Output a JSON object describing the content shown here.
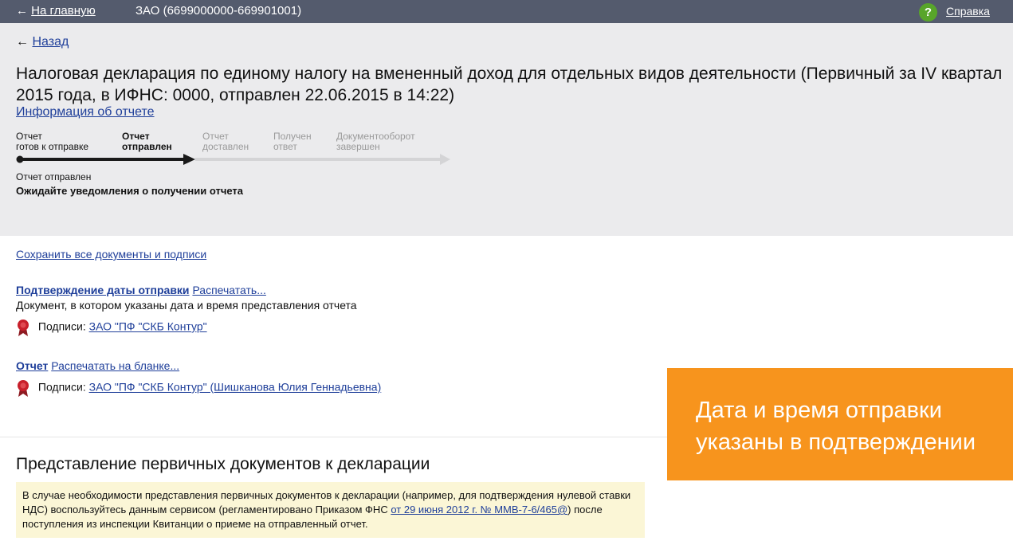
{
  "topbar": {
    "back_arrow": "←",
    "home_link": "На главную",
    "org": "ЗАО (6699000000-669901001)",
    "help_icon_glyph": "?",
    "help_link": "Справка"
  },
  "nav": {
    "back_arrow": "←",
    "back_link": "Назад"
  },
  "report": {
    "title": "Налоговая декларация по единому налогу на вмененный доход для отдельных видов деятельности (Первичный за IV квартал 2015 года, в ИФНС: 0000, отправлен 22.06.2015 в 14:22)",
    "info_link": "Информация об отчете"
  },
  "progress": {
    "steps": [
      {
        "line1": "Отчет",
        "line2": "готов к отправке"
      },
      {
        "line1": "Отчет",
        "line2": "отправлен"
      },
      {
        "line1": "Отчет",
        "line2": "доставлен"
      },
      {
        "line1": "Получен",
        "line2": "ответ"
      },
      {
        "line1": "Документооборот",
        "line2": "завершен"
      }
    ],
    "status": "Отчет отправлен",
    "status_detail": "Ожидайте уведомления о получении отчета"
  },
  "documents": {
    "save_all_link": "Сохранить все документы и подписи",
    "confirmation": {
      "title": "Подтверждение даты отправки",
      "print_link": "Распечатать...",
      "description": "Документ, в котором указаны дата и время представления отчета",
      "signatures_label": "Подписи:",
      "signer_link": "ЗАО \"ПФ \"СКБ Контур\""
    },
    "report_doc": {
      "title": "Отчет",
      "print_link": "Распечатать на бланке...",
      "signatures_label": "Подписи:",
      "signer_link": "ЗАО \"ПФ \"СКБ Контур\" (Шишканова Юлия Геннадьевна)"
    }
  },
  "primary_docs": {
    "heading": "Представление первичных документов к декларации",
    "notice_text_1": "В случае необходимости представления первичных документов к декларации (например, для подтверждения нулевой ставки НДС) воспользуйтесь данным сервисом (регламентировано Приказом ФНС ",
    "notice_link": "от 29 июня 2012 г. № ММВ-7-6/465@",
    "notice_text_2": ") после поступления из инспекции Квитанции о приеме на отправленный отчет."
  },
  "callout": {
    "line1": "Дата и время отправки",
    "line2": "указаны в подтверждении"
  },
  "colors": {
    "topbar": "#545b6d",
    "header_bg": "#ebebed",
    "link": "#1f3f9a",
    "help_green": "#58a52a",
    "callout_orange": "#f7941d",
    "notice_bg": "#fbf6d6",
    "seal_red": "#c8202b"
  }
}
